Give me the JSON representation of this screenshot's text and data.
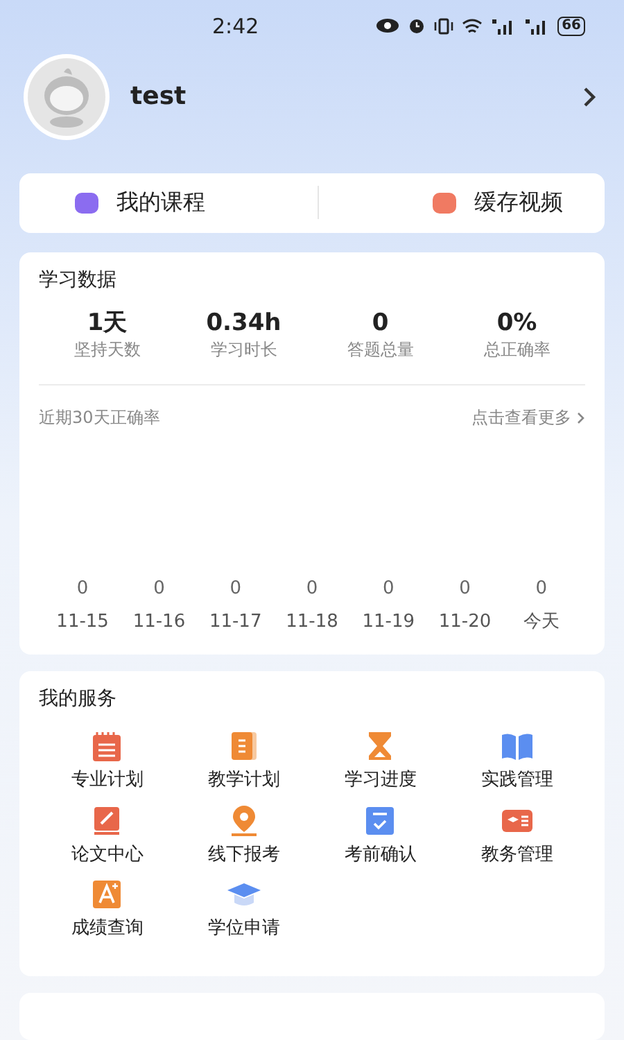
{
  "status_bar": {
    "time": "2:42",
    "battery": "66"
  },
  "profile": {
    "name": "test"
  },
  "shortcuts": [
    {
      "label": "我的课程",
      "color": "#8b6cf0"
    },
    {
      "label": "缓存视频",
      "color": "#f07a62"
    }
  ],
  "study_data": {
    "title": "学习数据",
    "stats": [
      {
        "value": "1天",
        "label": "坚持天数"
      },
      {
        "value": "0.34h",
        "label": "学习时长"
      },
      {
        "value": "0",
        "label": "答题总量"
      },
      {
        "value": "0%",
        "label": "总正确率"
      }
    ],
    "chart_title": "近期30天正确率",
    "more_link": "点击查看更多",
    "daily": [
      {
        "value": "0",
        "date": "11-15"
      },
      {
        "value": "0",
        "date": "11-16"
      },
      {
        "value": "0",
        "date": "11-17"
      },
      {
        "value": "0",
        "date": "11-18"
      },
      {
        "value": "0",
        "date": "11-19"
      },
      {
        "value": "0",
        "date": "11-20"
      },
      {
        "value": "0",
        "date": "今天"
      }
    ]
  },
  "services": {
    "title": "我的服务",
    "items": [
      {
        "label": "专业计划"
      },
      {
        "label": "教学计划"
      },
      {
        "label": "学习进度"
      },
      {
        "label": "实践管理"
      },
      {
        "label": "论文中心"
      },
      {
        "label": "线下报考"
      },
      {
        "label": "考前确认"
      },
      {
        "label": "教务管理"
      },
      {
        "label": "成绩查询"
      },
      {
        "label": "学位申请"
      }
    ]
  }
}
